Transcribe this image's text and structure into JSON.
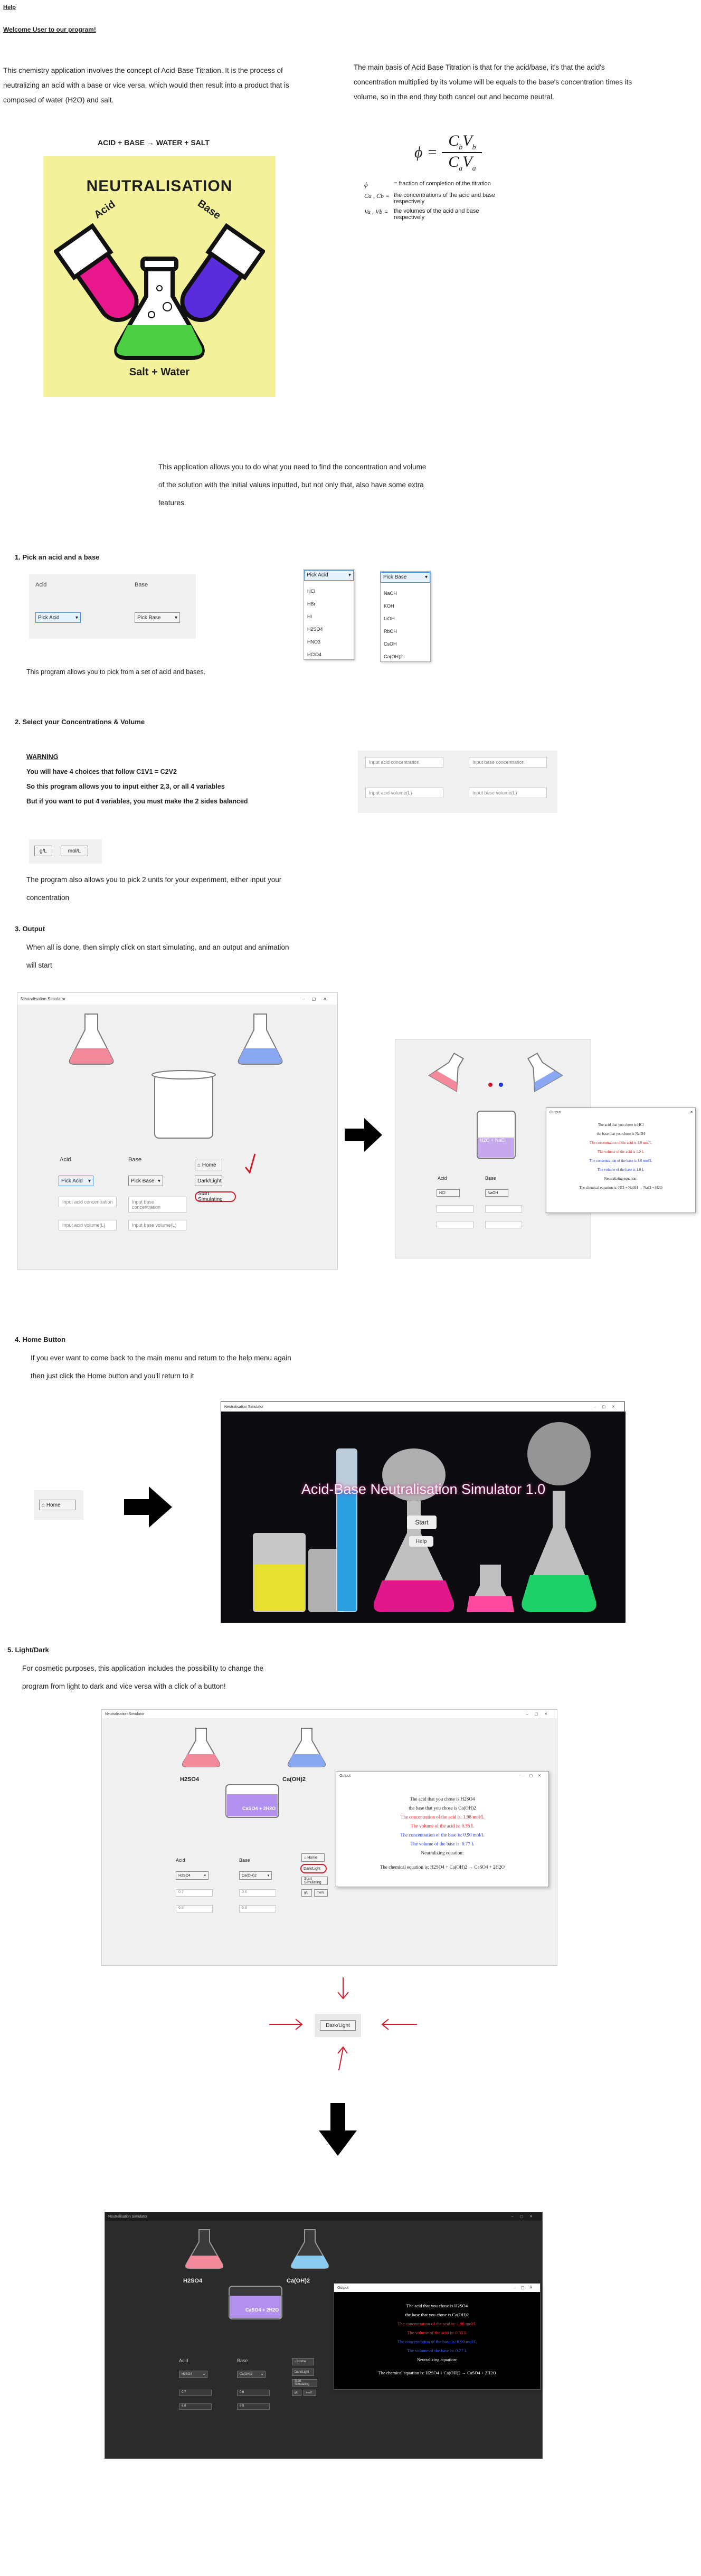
{
  "top": {
    "help": "Help",
    "welcome": "Welcome User to our program!"
  },
  "intro": {
    "left_lines": [
      "This chemistry application involves the concept of Acid-Base Titration. It is the process of",
      "neutralizing an acid with a base or vice versa, which would then result into a product that is",
      "composed of water (H2O) and salt."
    ],
    "right_lines": [
      "The main basis of Acid Base Titration is that for the acid/base, it's that the acid's",
      "concentration multiplied by its volume will be equals to the base's concentration times its",
      "volume, so in the end they both cancel out and become neutral."
    ],
    "equation_caption": "ACID + BASE → WATER + SALT",
    "poster": {
      "title": "NEUTRALISATION",
      "acid": "Acid",
      "base": "Base",
      "product": "Salt + Water"
    },
    "formula": {
      "lhs": "ϕ",
      "eq": "=",
      "num": "CbVb",
      "den": "CaVa"
    },
    "legend": [
      {
        "sym": "ϕ",
        "text": "= fraction of completion of the titration"
      },
      {
        "sym": "Ca , Cb =",
        "text": "the concentrations of the acid and base respectively"
      },
      {
        "sym": "Va , Vb =",
        "text": "the volumes of the acid and base respectively"
      }
    ],
    "app_lines": [
      "This application allows you to do what you need to find the concentration and volume",
      "of the solution with the initial values inputted, but not only that, also have some extra",
      "features."
    ]
  },
  "s1": {
    "heading": "1.   Pick an acid and a base",
    "acid_label": "Acid",
    "base_label": "Base",
    "acid_select": "Pick Acid",
    "base_select": "Pick Base",
    "acid_options": [
      "HCl",
      "HBr",
      "HI",
      "H2SO4",
      "HNO3",
      "HClO4"
    ],
    "base_options": [
      "NaOH",
      "KOH",
      "LiOH",
      "RbOH",
      "CsOH",
      "Ca(OH)2"
    ],
    "desc": "This program allows you to pick from a set of acid and bases."
  },
  "s2": {
    "heading": "2.   Select your Concentrations & Volume",
    "warning": "WARNING",
    "rule1": "You will have 4 choices that follow C1V1 = C2V2",
    "rule2": "So this program allows you to input either 2,3, or all 4 variables",
    "rule3": "But if you want to put 4 variables, you must make the 2 sides balanced",
    "ph_acid_conc": "Input acid concentration",
    "ph_base_conc": "Input base concentration",
    "ph_acid_vol": "Input acid volume(L)",
    "ph_base_vol": "Input base volume(L)",
    "unit1": "g/L",
    "unit2": "mol/L",
    "desc_lines": [
      "The program also allows you to pick 2 units for your experiment, either input your",
      "concentration"
    ]
  },
  "s3": {
    "heading": "3.   Output",
    "desc_lines": [
      "When all is done, then simply click on start simulating, and an output and animation",
      "will start"
    ],
    "win_title": "Neutralisation Simulator",
    "acid_label": "Acid",
    "base_label": "Base",
    "sel1": "Pick Acid",
    "sel2": "Pick Base",
    "home": "Home",
    "light_dark": "Dark/Light",
    "start_sim": "Start Simulating",
    "field1": "Input acid concentration",
    "field2": "Input base concentration",
    "field3": "Input acid volume(L)",
    "field4": "Input base volume(L)",
    "beaker_label": "H2O + NaCl",
    "popup_title": "Output",
    "popup_lines": [
      "The acid that you chose is HCl",
      "the base that you chose is NaOH",
      "The concentration of the acid is 1.0 mol/L",
      "The volume of the acid is 1.0 L",
      "The concentration of the base is 1.0 mol/L",
      "The volume of the base is 1.0 L",
      "Neutralizing equation:",
      "The chemical equation is: HCl + NaOH → NaCl + H2O"
    ]
  },
  "s4": {
    "heading": "4.   Home Button",
    "desc_lines": [
      "If you ever want to come back to the main menu and return to the help menu again",
      "then just click the Home button and you'll return to it"
    ],
    "home": "Home",
    "win_title": "Neutralisation Simulator",
    "splash_title": "Acid-Base Neutralisation Simulator 1.0",
    "start": "Start",
    "help": "Help"
  },
  "s5": {
    "heading": "5.   Light/Dark",
    "desc_lines": [
      "For cosmetic purposes, this application includes the possibility to change the",
      "program from light to dark and vice versa with a click of a button!"
    ],
    "win_title": "Neutralisation Simulator",
    "acid_name": "H2SO4",
    "base_name": "Ca(OH)2",
    "beaker": "CaSO4 + 2H2O",
    "acid_label": "Acid",
    "base_label": "Base",
    "sel1": "H2SO4",
    "sel2": "Ca(OH)2",
    "home": "Home",
    "dark_light": "Dark/Light",
    "start_sim": "Start Simulating",
    "in1": "0.7",
    "in2": "0.6",
    "in3": "6.8",
    "in4": "6.8",
    "u1": "g/L",
    "u2": "mol/L",
    "popup_title": "Output",
    "popup_lines": [
      {
        "t": "The acid that you chose is H2SO4",
        "c": "#222"
      },
      {
        "t": "the base that you chose is Ca(OH)2",
        "c": "#222"
      },
      {
        "t": "The concentration of the acid is: 1.98 mol/L",
        "c": "#d61b1b"
      },
      {
        "t": "The volume of the acid is: 0.35 L",
        "c": "#d61b1b"
      },
      {
        "t": "The concentration of the base is: 0.90 mol/L",
        "c": "#2136d6"
      },
      {
        "t": "The volume of the base is: 0.77 L",
        "c": "#2136d6"
      },
      {
        "t": "Neutralizing equation:",
        "c": "#222"
      },
      {
        "t": "The chemical equation is: H2SO4 + Ca(OH)2  →  CaSO4 + 2H2O",
        "c": "#222"
      }
    ],
    "center_button": "Dark/Light"
  },
  "colors": {
    "acid": "#f25a8a",
    "base": "#6f8ff0",
    "accent": "#d41a2a",
    "poster": "#f3f19a"
  }
}
